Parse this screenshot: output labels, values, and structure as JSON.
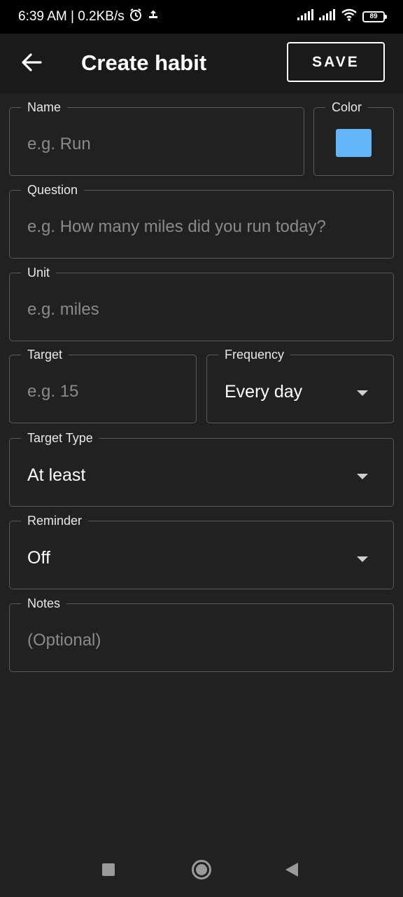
{
  "status_bar": {
    "time_speed": "6:39 AM | 0.2KB/s",
    "battery": "89",
    "icons": [
      "alarm-icon",
      "cloud-upload-icon",
      "signal-icon",
      "signal-icon",
      "wifi-icon",
      "battery-icon"
    ]
  },
  "app_bar": {
    "back_icon": "arrow-left-icon",
    "title": "Create habit",
    "save_label": "SAVE"
  },
  "form": {
    "name": {
      "label": "Name",
      "placeholder": "e.g. Run"
    },
    "color": {
      "label": "Color",
      "value": "#64b5f6"
    },
    "question": {
      "label": "Question",
      "placeholder": "e.g. How many miles did you run today?"
    },
    "unit": {
      "label": "Unit",
      "placeholder": "e.g. miles"
    },
    "target": {
      "label": "Target",
      "placeholder": "e.g. 15"
    },
    "frequency": {
      "label": "Frequency",
      "value": "Every day"
    },
    "target_type": {
      "label": "Target Type",
      "value": "At least"
    },
    "reminder": {
      "label": "Reminder",
      "value": "Off"
    },
    "notes": {
      "label": "Notes",
      "placeholder": "(Optional)"
    }
  },
  "nav_bar": {
    "icons": [
      "recents-square-icon",
      "home-circle-icon",
      "back-triangle-icon"
    ]
  },
  "colors": {
    "background": "#212121",
    "app_bar": "#1a1a1a",
    "outline": "#5a5a5a",
    "accent_swatch": "#64b5f6"
  }
}
